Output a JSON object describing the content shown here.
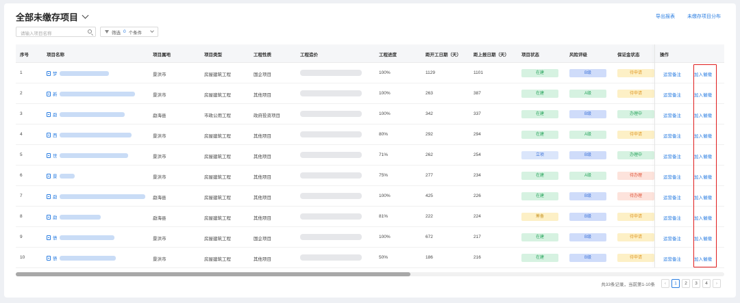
{
  "header": {
    "title": "全部未缴存项目",
    "export_label": "导出报表",
    "distribution_label": "未缴存项目分布"
  },
  "toolbar": {
    "search_placeholder": "请输入项目名称",
    "filter_label": "筛选",
    "filter_count": "0",
    "filter_unit": "个条件"
  },
  "table": {
    "columns": [
      "序号",
      "项目名称",
      "项目属地",
      "项目类型",
      "工程性质",
      "工程造价",
      "工程进度",
      "距开工日期（天）",
      "距上报日期（天）",
      "项目状态",
      "风险评级",
      "保证金状态",
      "操作"
    ],
    "rows": [
      {
        "no": "1",
        "name_prefix": "梦",
        "location": "景洪市",
        "type": "房屋建筑工程",
        "nature": "国企项目",
        "progress": "100%",
        "start_days": "1129",
        "report_days": "1101",
        "status": "在建",
        "risk": "B级",
        "deposit": "待申请",
        "name_w": 72,
        "status_c": "st-green",
        "risk_c": "r-blue",
        "deposit_c": "g-yellow"
      },
      {
        "no": "2",
        "name_prefix": "新",
        "location": "景洪市",
        "type": "房屋建筑工程",
        "nature": "其他项目",
        "progress": "100%",
        "start_days": "263",
        "report_days": "387",
        "status": "在建",
        "risk": "A级",
        "deposit": "待申请",
        "name_w": 110,
        "status_c": "st-green",
        "risk_c": "r-green",
        "deposit_c": "g-yellow"
      },
      {
        "no": "3",
        "name_prefix": "勐",
        "location": "勐海县",
        "type": "市政公用工程",
        "nature": "政府投资项目",
        "progress": "100%",
        "start_days": "342",
        "report_days": "337",
        "status": "在建",
        "risk": "B级",
        "deposit": "办理中",
        "name_w": 95,
        "status_c": "st-green",
        "risk_c": "r-blue",
        "deposit_c": "g-green"
      },
      {
        "no": "4",
        "name_prefix": "西",
        "location": "景洪市",
        "type": "房屋建筑工程",
        "nature": "其他项目",
        "progress": "80%",
        "start_days": "292",
        "report_days": "294",
        "status": "在建",
        "risk": "A级",
        "deposit": "待申请",
        "name_w": 105,
        "status_c": "st-green",
        "risk_c": "r-green",
        "deposit_c": "g-yellow"
      },
      {
        "no": "5",
        "name_prefix": "世",
        "location": "景洪市",
        "type": "房屋建筑工程",
        "nature": "其他项目",
        "progress": "71%",
        "start_days": "262",
        "report_days": "254",
        "status": "立项",
        "risk": "B级",
        "deposit": "办理中",
        "name_w": 100,
        "status_c": "st-blue",
        "risk_c": "r-blue",
        "deposit_c": "g-green"
      },
      {
        "no": "6",
        "name_prefix": "景",
        "location": "景洪市",
        "type": "房屋建筑工程",
        "nature": "其他项目",
        "progress": "75%",
        "start_days": "277",
        "report_days": "234",
        "status": "在建",
        "risk": "A级",
        "deposit": "待办理",
        "name_w": 22,
        "status_c": "st-green",
        "risk_c": "r-green",
        "deposit_c": "g-red"
      },
      {
        "no": "7",
        "name_prefix": "勐",
        "location": "勐海县",
        "type": "房屋建筑工程",
        "nature": "其他项目",
        "progress": "100%",
        "start_days": "425",
        "report_days": "226",
        "status": "在建",
        "risk": "B级",
        "deposit": "待办理",
        "name_w": 125,
        "status_c": "st-green",
        "risk_c": "r-blue",
        "deposit_c": "g-red"
      },
      {
        "no": "8",
        "name_prefix": "勐",
        "location": "勐海县",
        "type": "房屋建筑工程",
        "nature": "其他项目",
        "progress": "81%",
        "start_days": "222",
        "report_days": "224",
        "status": "筹备",
        "risk": "B级",
        "deposit": "待申请",
        "name_w": 60,
        "status_c": "st-yellow",
        "risk_c": "r-blue",
        "deposit_c": "g-yellow"
      },
      {
        "no": "9",
        "name_prefix": "债",
        "location": "景洪市",
        "type": "房屋建筑工程",
        "nature": "国企项目",
        "progress": "100%",
        "start_days": "672",
        "report_days": "217",
        "status": "在建",
        "risk": "B级",
        "deposit": "待申请",
        "name_w": 80,
        "status_c": "st-green",
        "risk_c": "r-blue",
        "deposit_c": "g-yellow"
      },
      {
        "no": "10",
        "name_prefix": "债",
        "location": "景洪市",
        "type": "房屋建筑工程",
        "nature": "其他项目",
        "progress": "50%",
        "start_days": "186",
        "report_days": "216",
        "status": "在建",
        "risk": "B级",
        "deposit": "待申请",
        "name_w": 82,
        "status_c": "st-green",
        "risk_c": "r-blue",
        "deposit_c": "g-yellow"
      }
    ],
    "op_remark": "运营备注",
    "op_urge": "加入催缴"
  },
  "pagination": {
    "summary": "共33条记录，当前第1-10条",
    "pages": [
      "1",
      "2",
      "3",
      "4"
    ],
    "current": "1",
    "prev": "‹",
    "next": "›"
  }
}
